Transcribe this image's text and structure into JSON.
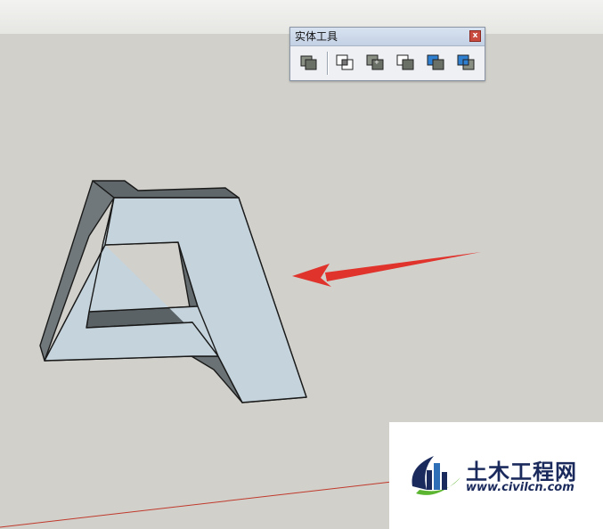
{
  "toolbar": {
    "title": "实体工具",
    "close_glyph": "x",
    "tools": [
      {
        "name": "outer-shell-tool-icon",
        "color": "#8a8f84"
      },
      {
        "name": "intersect-tool-icon",
        "color": "#ffffff"
      },
      {
        "name": "union-tool-icon",
        "color": "#8a8f84"
      },
      {
        "name": "subtract-tool-icon",
        "color": "#ffffff"
      },
      {
        "name": "trim-tool-icon",
        "color": "#2f7fd0"
      },
      {
        "name": "split-tool-icon",
        "color": "#2f7fd0"
      }
    ]
  },
  "watermark": {
    "name": "土木工程网",
    "url": "www.civilcn.com"
  },
  "colors": {
    "background": "#d1d0cb",
    "model_face": "#c4d3dc",
    "model_side": "#6e7679",
    "arrow": "#e0332c",
    "axis_red": "#c0392b",
    "logo_blue": "#1b2a5c",
    "logo_green": "#5cb531"
  }
}
